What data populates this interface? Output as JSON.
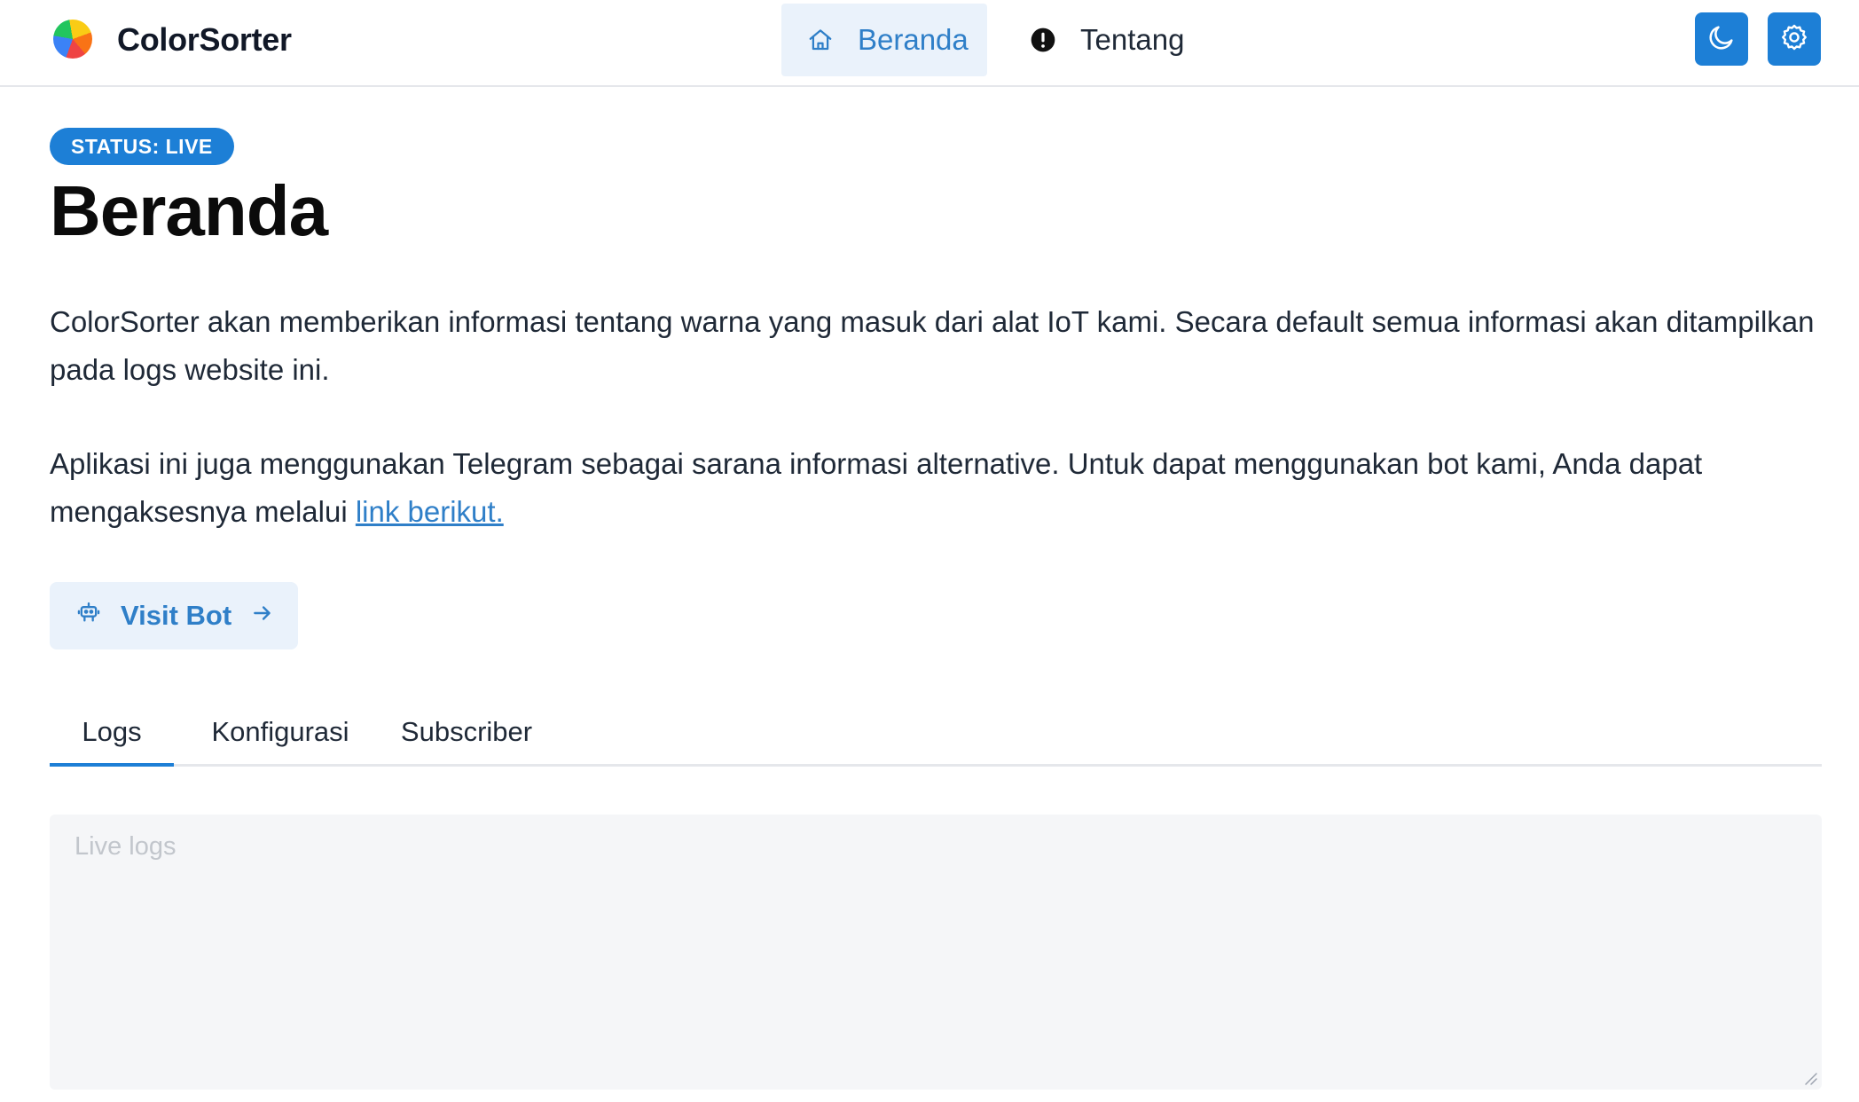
{
  "header": {
    "brand": "ColorSorter",
    "nav": [
      {
        "label": "Beranda",
        "icon": "home-icon",
        "active": true
      },
      {
        "label": "Tentang",
        "icon": "info-icon",
        "active": false
      }
    ],
    "actions": [
      {
        "icon": "moon-icon"
      },
      {
        "icon": "gear-icon"
      }
    ]
  },
  "main": {
    "badge": "STATUS: LIVE",
    "title": "Beranda",
    "paragraph1": "ColorSorter akan memberikan informasi tentang warna yang masuk dari alat IoT kami. Secara default semua informasi akan ditampilkan pada logs website ini.",
    "paragraph2_prefix": "Aplikasi ini juga menggunakan Telegram sebagai sarana informasi alternative. Untuk dapat menggunakan bot kami, Anda dapat mengaksesnya melalui ",
    "paragraph2_link": "link berikut.",
    "visit_button": "Visit Bot",
    "tabs": [
      {
        "label": "Logs",
        "active": true
      },
      {
        "label": "Konfigurasi",
        "active": false
      },
      {
        "label": "Subscriber",
        "active": false
      }
    ],
    "logs_placeholder": "Live logs",
    "logs_value": ""
  },
  "colors": {
    "accent": "#1d7fd6",
    "accent_text": "#2f7fc8",
    "accent_soft": "#eaf2fb",
    "border": "#e5e7eb",
    "logs_bg": "#f5f6f8"
  }
}
